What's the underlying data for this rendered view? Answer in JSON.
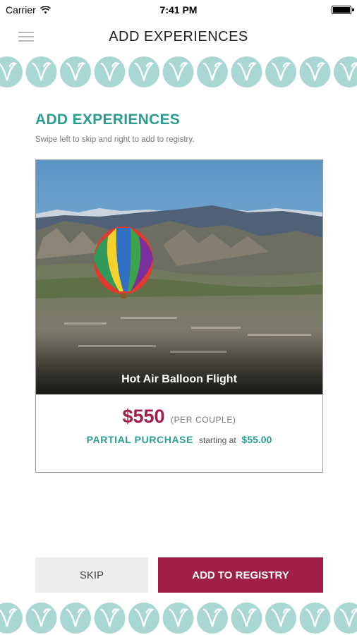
{
  "status_bar": {
    "carrier": "Carrier",
    "time": "7:41 PM",
    "wifi_icon": "wifi-icon",
    "battery_level": 1.0
  },
  "nav": {
    "title": "ADD EXPERIENCES",
    "menu_icon": "hamburger-menu-icon"
  },
  "header": {
    "title": "ADD EXPERIENCES",
    "subtitle": "Swipe left to skip and right to add to registry."
  },
  "card": {
    "name": "Hot Air Balloon Flight",
    "price": "$550",
    "price_unit": "(PER COUPLE)",
    "partial_label": "PARTIAL PURCHASE",
    "starting_text": "starting at",
    "partial_price": "$55.00"
  },
  "buttons": {
    "skip": "SKIP",
    "add": "ADD TO REGISTRY"
  },
  "colors": {
    "accent_teal": "#2a9d8f",
    "brand_maroon": "#a01f46",
    "pattern_mint": "#a9d7d3"
  }
}
